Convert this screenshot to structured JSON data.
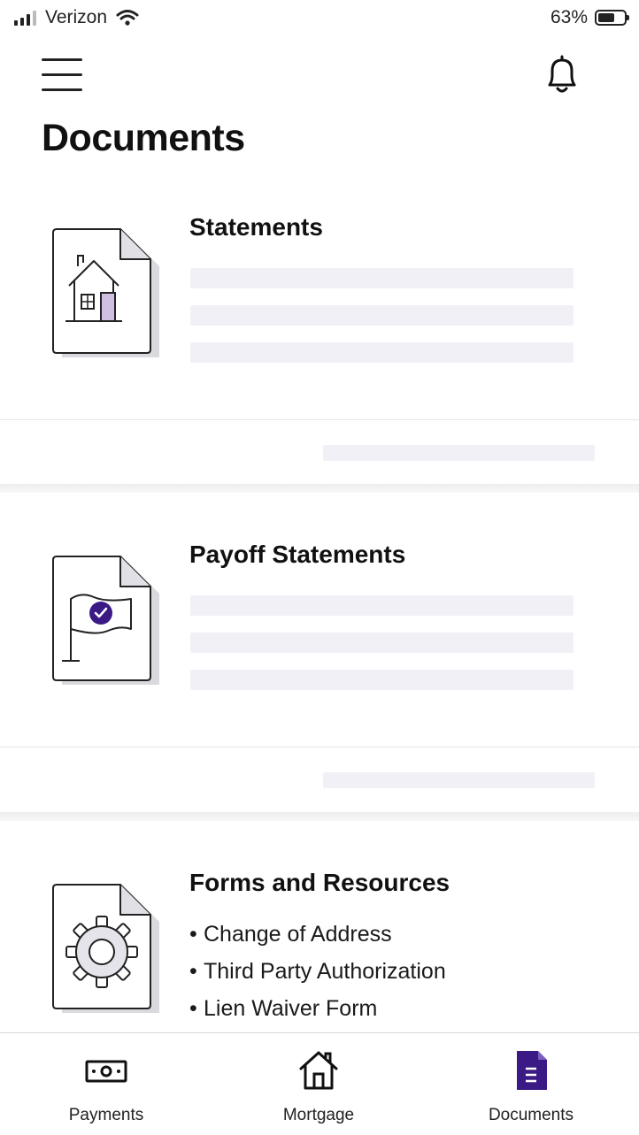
{
  "status_bar": {
    "carrier": "Verizon",
    "battery_percent": "63%",
    "battery_level": 0.63
  },
  "header": {
    "menu_icon": "hamburger-menu-icon",
    "notifications_icon": "bell-icon",
    "title": "Documents"
  },
  "cards": {
    "statements": {
      "title": "Statements",
      "icon": "house-document-icon"
    },
    "payoff": {
      "title": "Payoff Statements",
      "icon": "flag-check-document-icon"
    },
    "forms": {
      "title": "Forms and Resources",
      "icon": "gear-document-icon",
      "items": [
        "Change of Address",
        "Third Party Authorization",
        "Lien Waiver Form"
      ]
    }
  },
  "bottom_nav": {
    "items": [
      {
        "label": "Payments",
        "icon": "money-bill-icon"
      },
      {
        "label": "Mortgage",
        "icon": "house-icon"
      },
      {
        "label": "Documents",
        "icon": "document-icon"
      }
    ],
    "active": "Documents"
  },
  "colors": {
    "accent": "#3b1a86",
    "skeleton": "#f1f0f7",
    "text": "#111111"
  }
}
